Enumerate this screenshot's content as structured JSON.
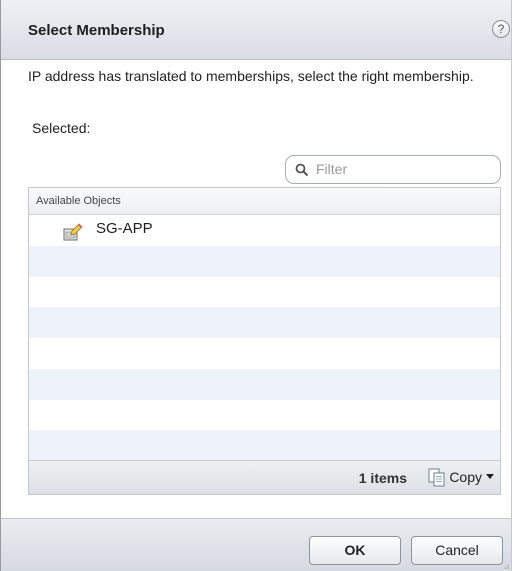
{
  "dialog": {
    "title": "Select Membership",
    "help_symbol": "?",
    "description": "IP address has translated to memberships, select the right membership.",
    "selected_label": "Selected:"
  },
  "filter": {
    "placeholder": "Filter",
    "icon": "search-icon"
  },
  "grid": {
    "column_header": "Available Objects",
    "items": [
      {
        "label": "SG-APP",
        "icon": "security-group-icon"
      }
    ],
    "empty_rows": 7,
    "count_text": "1 items",
    "copy_label": "Copy"
  },
  "buttons": {
    "ok": "OK",
    "cancel": "Cancel"
  },
  "colors": {
    "alt_row": "#eef3f9",
    "titlebar": "#d9dde4"
  }
}
